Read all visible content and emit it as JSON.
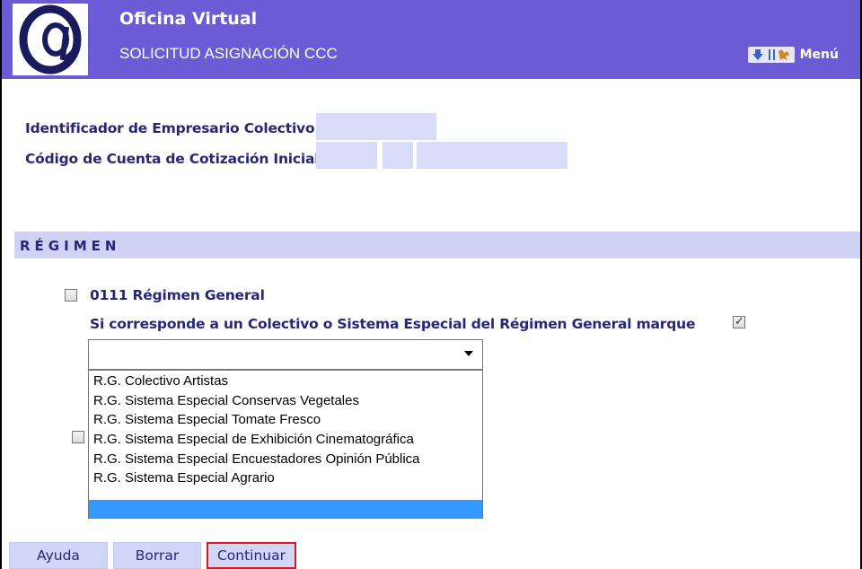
{
  "header": {
    "app_title": "Oficina Virtual",
    "subtitle": "SOLICITUD ASIGNACIÓN CCC",
    "menu_label": "Menú",
    "logo_icon": "at-sign-logo-icon",
    "background": "#6b5cd6"
  },
  "info": {
    "empresario_label": "Identificador de Empresario Colectivo",
    "cuenta_label": "Código de Cuenta de Cotización Inicial"
  },
  "section": {
    "title": "RÉGIMEN"
  },
  "regimen": {
    "general_label": "0111 Régimen General",
    "general_checked": false,
    "especial_question": "Si corresponde a un Colectivo o Sistema Especial del Régimen General marque",
    "especial_checked": true,
    "second_checkbox_checked": false
  },
  "select": {
    "value": "",
    "options": [
      "R.G. Colectivo Artistas",
      "R.G. Sistema Especial Conservas Vegetales",
      "R.G. Sistema Especial Tomate Fresco",
      "R.G. Sistema Especial de Exhibición Cinematográfica",
      "R.G. Sistema Especial Encuestadores Opinión Pública",
      "R.G. Sistema Especial Agrario",
      ""
    ],
    "highlight_color": "#3399ff"
  },
  "buttons": {
    "ayuda": "Ayuda",
    "borrar": "Borrar",
    "continuar": "Continuar"
  },
  "colors": {
    "label_text": "#27277a",
    "field_fill": "#d9dcf9",
    "section_fill": "#d0d2f4",
    "button_fill": "#d2d6f6",
    "highlight_border": "#d41a1a"
  }
}
